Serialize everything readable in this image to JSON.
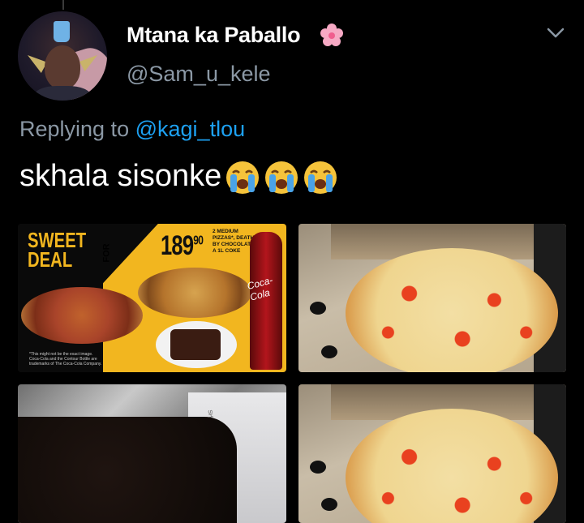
{
  "user": {
    "display_name": "Mtana ka Paballo",
    "name_emoji": "cherry-blossom-icon",
    "handle": "@Sam_u_kele"
  },
  "reply": {
    "prefix": "Replying to",
    "mention": "@kagi_tlou"
  },
  "tweet": {
    "text": "skhala sisonke",
    "emojis": [
      "loudly-crying-face-icon",
      "loudly-crying-face-icon",
      "loudly-crying-face-icon"
    ]
  },
  "media": {
    "ad": {
      "headline": "SWEET DEAL",
      "side_label": "FOR",
      "price_main": "189",
      "price_cents": "90",
      "description": "2 MEDIUM PIZZAS*, DEATH BY CHOCOLATE & A 1L COKE",
      "brand": "Coca-Cola",
      "fine_print": "*This might not be the exact image. Coca-Cola and the Contour Bottle are trademarks of The Coca-Cola Company."
    },
    "box_label": "SHERY"
  },
  "colors": {
    "background": "#000000",
    "link": "#1da1f2",
    "muted": "#8b98a5",
    "ad_yellow": "#f2b61f"
  }
}
